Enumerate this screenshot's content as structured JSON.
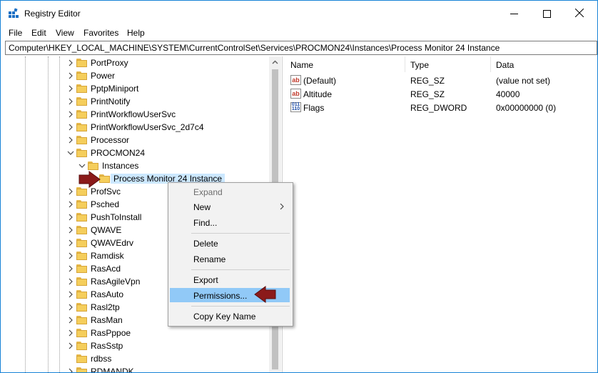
{
  "window": {
    "title": "Registry Editor"
  },
  "menu": [
    "File",
    "Edit",
    "View",
    "Favorites",
    "Help"
  ],
  "address": "Computer\\HKEY_LOCAL_MACHINE\\SYSTEM\\CurrentControlSet\\Services\\PROCMON24\\Instances\\Process Monitor 24 Instance",
  "tree": {
    "items": [
      {
        "label": "PortProxy",
        "state": "collapsed",
        "level": 0
      },
      {
        "label": "Power",
        "state": "collapsed",
        "level": 0
      },
      {
        "label": "PptpMiniport",
        "state": "collapsed",
        "level": 0
      },
      {
        "label": "PrintNotify",
        "state": "collapsed",
        "level": 0
      },
      {
        "label": "PrintWorkflowUserSvc",
        "state": "collapsed",
        "level": 0
      },
      {
        "label": "PrintWorkflowUserSvc_2d7c4",
        "state": "collapsed",
        "level": 0
      },
      {
        "label": "Processor",
        "state": "collapsed",
        "level": 0
      },
      {
        "label": "PROCMON24",
        "state": "expanded",
        "level": 0
      },
      {
        "label": "Instances",
        "state": "expanded",
        "level": 1
      },
      {
        "label": "Process Monitor 24 Instance",
        "state": "selected",
        "level": 2
      },
      {
        "label": "ProfSvc",
        "state": "collapsed",
        "level": 0
      },
      {
        "label": "Psched",
        "state": "collapsed",
        "level": 0
      },
      {
        "label": "PushToInstall",
        "state": "collapsed",
        "level": 0
      },
      {
        "label": "QWAVE",
        "state": "collapsed",
        "level": 0
      },
      {
        "label": "QWAVEdrv",
        "state": "collapsed",
        "level": 0
      },
      {
        "label": "Ramdisk",
        "state": "collapsed",
        "level": 0
      },
      {
        "label": "RasAcd",
        "state": "collapsed",
        "level": 0
      },
      {
        "label": "RasAgileVpn",
        "state": "collapsed",
        "level": 0
      },
      {
        "label": "RasAuto",
        "state": "collapsed",
        "level": 0
      },
      {
        "label": "Rasl2tp",
        "state": "collapsed",
        "level": 0
      },
      {
        "label": "RasMan",
        "state": "collapsed",
        "level": 0
      },
      {
        "label": "RasPppoe",
        "state": "collapsed",
        "level": 0
      },
      {
        "label": "RasSstp",
        "state": "collapsed",
        "level": 0
      },
      {
        "label": "rdbss",
        "state": "leaf",
        "level": 0
      },
      {
        "label": "RDMANDK",
        "state": "collapsed",
        "level": 0
      }
    ]
  },
  "values": {
    "columns": [
      "Name",
      "Type",
      "Data"
    ],
    "rows": [
      {
        "name": "(Default)",
        "type": "REG_SZ",
        "data": "(value not set)",
        "icon": "string-value-icon"
      },
      {
        "name": "Altitude",
        "type": "REG_SZ",
        "data": "40000",
        "icon": "string-value-icon"
      },
      {
        "name": "Flags",
        "type": "REG_DWORD",
        "data": "0x00000000 (0)",
        "icon": "binary-value-icon"
      }
    ]
  },
  "icons": {
    "string": "ab",
    "binary": "011 110"
  },
  "context_menu": {
    "items": [
      {
        "label": "Expand",
        "disabled": true
      },
      {
        "label": "New",
        "submenu": true
      },
      {
        "label": "Find..."
      },
      {
        "label": "Delete"
      },
      {
        "label": "Rename"
      },
      {
        "label": "Export"
      },
      {
        "label": "Permissions...",
        "highlighted": true
      },
      {
        "label": "Copy Key Name"
      }
    ]
  },
  "colors": {
    "accent": "#0078d7",
    "selection": "#cce8ff",
    "menu_hover": "#91c9f7",
    "annotation_arrow": "#8b1a1a"
  }
}
